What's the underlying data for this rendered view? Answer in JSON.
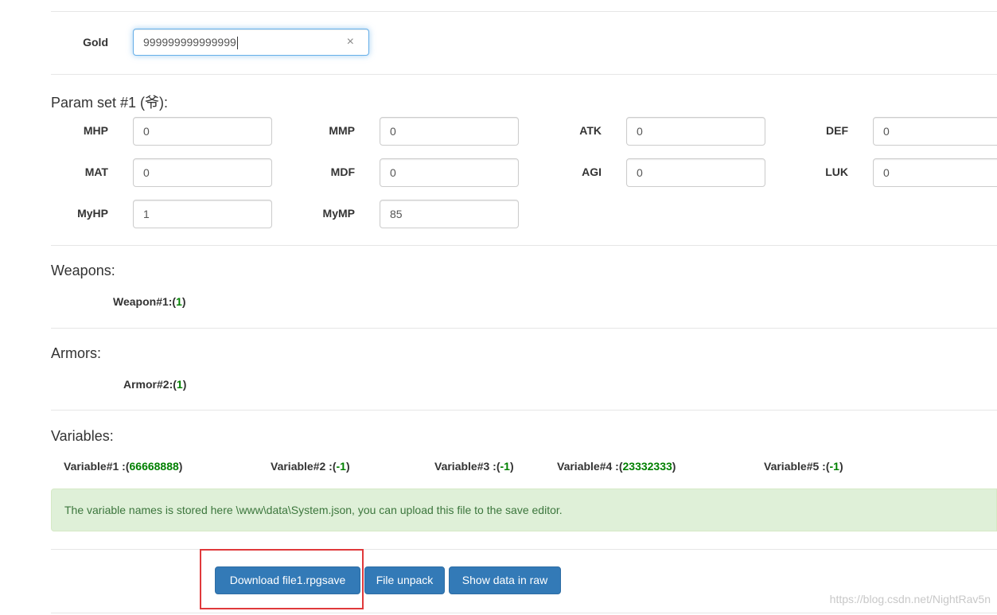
{
  "gold": {
    "label": "Gold",
    "value": "999999999999999",
    "clear_icon": "×"
  },
  "params": {
    "title": "Param set #1 (爷):",
    "fields": [
      {
        "label": "MHP",
        "value": "0"
      },
      {
        "label": "MMP",
        "value": "0"
      },
      {
        "label": "ATK",
        "value": "0"
      },
      {
        "label": "DEF",
        "value": "0"
      },
      {
        "label": "MAT",
        "value": "0"
      },
      {
        "label": "MDF",
        "value": "0"
      },
      {
        "label": "AGI",
        "value": "0"
      },
      {
        "label": "LUK",
        "value": "0"
      },
      {
        "label": "MyHP",
        "value": "1"
      },
      {
        "label": "MyMP",
        "value": "85"
      }
    ]
  },
  "weapons": {
    "title": "Weapons:",
    "items": [
      {
        "name": "Weapon#1:(",
        "count": "1",
        "close": ")"
      }
    ]
  },
  "armors": {
    "title": "Armors:",
    "items": [
      {
        "name": "Armor#2:(",
        "count": "1",
        "close": ")"
      }
    ]
  },
  "variables": {
    "title": "Variables:",
    "items": [
      {
        "name": "Variable#1 :(",
        "value": "66668888",
        "close": ")"
      },
      {
        "name": "Variable#2 :(",
        "value": "-1",
        "close": ")"
      },
      {
        "name": "Variable#3 :(",
        "value": "-1",
        "close": ")"
      },
      {
        "name": "Variable#4 :(",
        "value": "23332333",
        "close": ")"
      },
      {
        "name": "Variable#5 :(",
        "value": "-1",
        "close": ")"
      }
    ]
  },
  "info": {
    "text": "The variable names is stored here \\www\\data\\System.json, you can upload this file to the save editor."
  },
  "buttons": {
    "download": "Download file1.rpgsave",
    "unpack": "File unpack",
    "raw": "Show data in raw"
  },
  "watermark": "https://blog.csdn.net/NightRav5n",
  "colors": {
    "primary": "#337ab7",
    "success_bg": "#dff0d8",
    "success_text": "#3c763d",
    "value_green": "#008000",
    "highlight": "#e0393b"
  }
}
